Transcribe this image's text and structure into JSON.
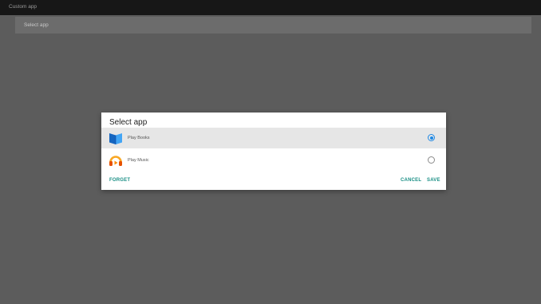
{
  "window": {
    "title": "Custom app"
  },
  "header": {
    "label": "Select app"
  },
  "dialog": {
    "title": "Select app",
    "items": [
      {
        "label": "Play Books",
        "icon": "play-books-icon",
        "selected": true
      },
      {
        "label": "Play Music",
        "icon": "play-music-icon",
        "selected": false
      }
    ],
    "forget_label": "FORGET",
    "cancel_label": "CANCEL",
    "save_label": "SAVE"
  },
  "colors": {
    "accent": "#1a8f85",
    "radio": "#1e88e5",
    "background": "#5c5c5c",
    "topbar": "#171717"
  }
}
